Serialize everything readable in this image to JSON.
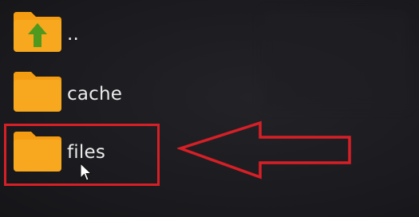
{
  "file_list": {
    "items": [
      {
        "label": "..",
        "icon": "folder-up-icon"
      },
      {
        "label": "cache",
        "icon": "folder-icon"
      },
      {
        "label": "files",
        "icon": "folder-icon"
      }
    ]
  },
  "annotation": {
    "highlight_color": "#d71f26",
    "arrow_icon": "arrow-left-outline-icon"
  },
  "colors": {
    "folder_main": "#f7a81e",
    "folder_tab": "#f59d12",
    "up_arrow": "#4f9a1e",
    "background": "#1b1b1f"
  }
}
